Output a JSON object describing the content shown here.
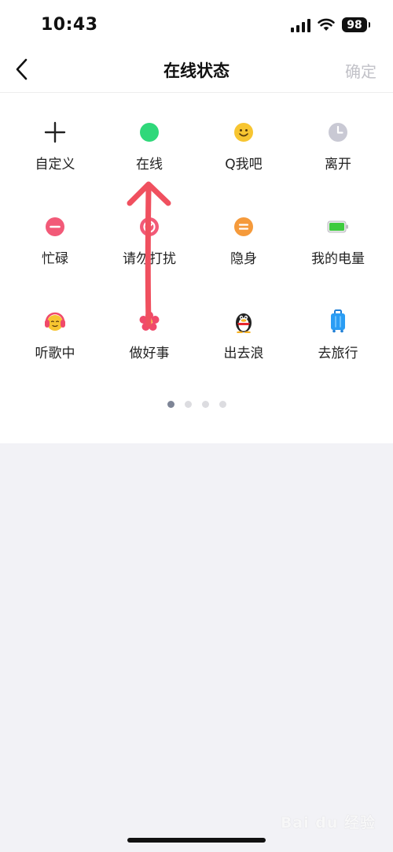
{
  "status_bar": {
    "time": "10:43",
    "battery": "98"
  },
  "nav": {
    "title": "在线状态",
    "confirm": "确定"
  },
  "status_grid": [
    {
      "label": "自定义",
      "icon": "plus-icon"
    },
    {
      "label": "在线",
      "icon": "online-dot-icon",
      "color": "#2fd87a"
    },
    {
      "label": "Q我吧",
      "icon": "smiley-icon",
      "color": "#f7c531"
    },
    {
      "label": "离开",
      "icon": "clock-icon",
      "color": "#c9c9d4"
    },
    {
      "label": "忙碌",
      "icon": "busy-minus-icon",
      "color": "#f25a78"
    },
    {
      "label": "请勿打扰",
      "icon": "do-not-disturb-icon",
      "color": "#f25a78"
    },
    {
      "label": "隐身",
      "icon": "invisible-icon",
      "color": "#f59a3b"
    },
    {
      "label": "我的电量",
      "icon": "battery-icon",
      "color": "#3ecb3e"
    },
    {
      "label": "听歌中",
      "icon": "headphone-face-icon",
      "color": "#f04a6a"
    },
    {
      "label": "做好事",
      "icon": "flower-icon",
      "color": "#f04a6a"
    },
    {
      "label": "出去浪",
      "icon": "penguin-icon",
      "color": "#222222"
    },
    {
      "label": "去旅行",
      "icon": "suitcase-icon",
      "color": "#2a9df4"
    }
  ],
  "pagination": {
    "pages": 4,
    "current": 1
  },
  "watermark": "Bai du 经验",
  "colors": {
    "annotation_arrow": "#f0505f",
    "active_dot": "#7e8596",
    "inactive_dot": "#dcdce0"
  }
}
